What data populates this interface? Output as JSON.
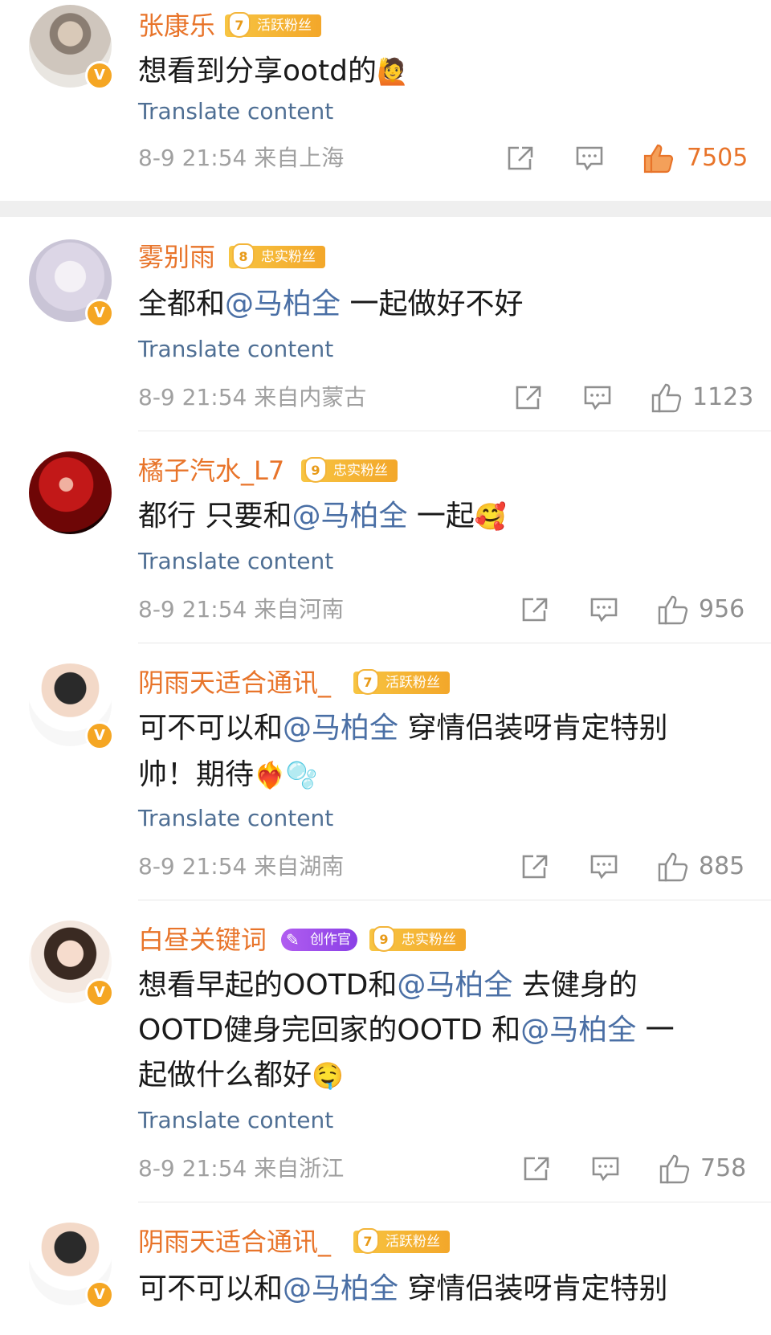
{
  "colors": {
    "username": "#e8742a",
    "mention": "#4a6fa5",
    "translate": "#4f6f94",
    "meta": "#a0a0a0",
    "like_active": "#e8742a",
    "fan_badge": "#f3a72a",
    "creator_badge": "#8a40e6"
  },
  "comments": [
    {
      "username": "张康乐",
      "fan_level": "7",
      "fan_label": "活跃粉丝",
      "text_parts": [
        "想看到分享ootd的"
      ],
      "emoji": "🙋",
      "translate": "Translate content",
      "time": "8-9 21:54",
      "location": "来自上海",
      "likes": "7505",
      "liked": true
    },
    {
      "username": "雾别雨",
      "fan_level": "8",
      "fan_label": "忠实粉丝",
      "text_before": "全都和",
      "mention": "@马柏全",
      "text_after": " 一起做好不好",
      "translate": "Translate content",
      "time": "8-9 21:54",
      "location": "来自内蒙古",
      "likes": "1123"
    },
    {
      "username": "橘子汽水_L7",
      "fan_level": "9",
      "fan_label": "忠实粉丝",
      "text_before": "都行 只要和",
      "mention": "@马柏全",
      "text_after": " 一起",
      "emoji": "🥰",
      "translate": "Translate content",
      "time": "8-9 21:54",
      "location": "来自河南",
      "likes": "956"
    },
    {
      "username": "阴雨天适合通讯_",
      "fan_level": "7",
      "fan_label": "活跃粉丝",
      "line1_before": "可不可以和",
      "mention": "@马柏全",
      "line1_after": " 穿情侣装呀肯定特别",
      "line2": "帅！期待",
      "emoji": "❤️‍🔥",
      "emoji2": "🫧",
      "translate": "Translate content",
      "time": "8-9 21:54",
      "location": "来自湖南",
      "likes": "885"
    },
    {
      "username": "白昼关键词",
      "creator_label": "创作官",
      "fan_level": "9",
      "fan_label": "忠实粉丝",
      "line1_before": "想看早起的OOTD和",
      "mention": "@马柏全",
      "line1_after": " 去健身的",
      "line2_before": "OOTD健身完回家的OOTD 和",
      "mention2": "@马柏全",
      "line2_after": " 一",
      "line3": "起做什么都好",
      "emoji": "🤤",
      "translate": "Translate content",
      "time": "8-9 21:54",
      "location": "来自浙江",
      "likes": "758"
    },
    {
      "username": "阴雨天适合通讯_",
      "fan_level": "7",
      "fan_label": "活跃粉丝",
      "line1_before": "可不可以和",
      "mention": "@马柏全",
      "line1_after": " 穿情侣装呀肯定特别"
    }
  ]
}
